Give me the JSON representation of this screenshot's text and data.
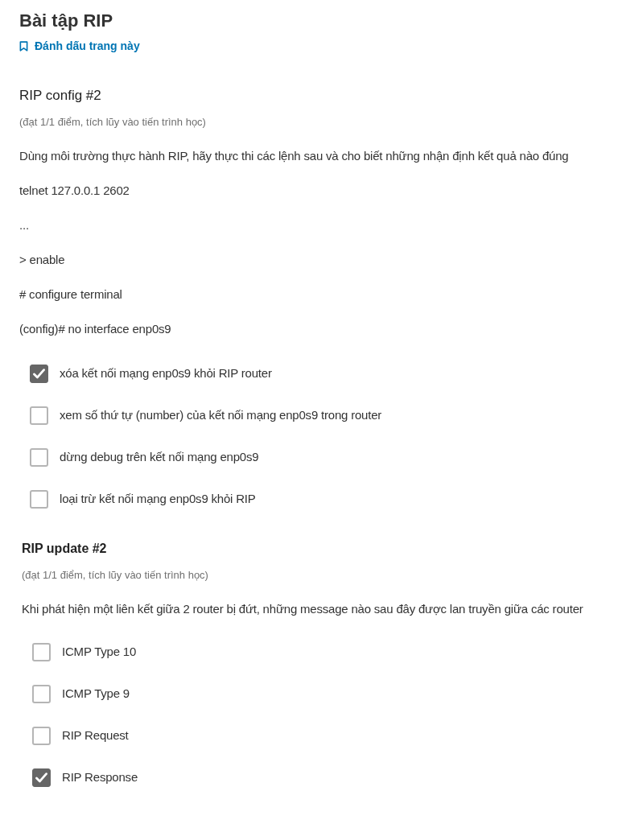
{
  "page": {
    "title": "Bài tập RIP",
    "bookmark": "Đánh dấu trang này"
  },
  "problems": [
    {
      "title": "RIP config #2",
      "score": "(đạt 1/1 điểm, tích lũy vào tiến trình học)",
      "prompt": [
        "Dùng môi trường thực hành RIP, hãy thực thi các lệnh sau và cho biết những nhận định kết quả nào đúng",
        "telnet 127.0.0.1 2602",
        "...",
        "> enable",
        "# configure terminal",
        "(config)# no interface enp0s9"
      ],
      "choices": [
        {
          "label": "xóa kết nối mạng enp0s9 khỏi RIP router",
          "checked": true
        },
        {
          "label": "xem số thứ tự (number) của kết nối mạng enp0s9 trong router",
          "checked": false
        },
        {
          "label": "dừng debug trên kết nối mạng enp0s9",
          "checked": false
        },
        {
          "label": "loại trừ kết nối mạng enp0s9 khỏi RIP",
          "checked": false
        }
      ]
    },
    {
      "title": "RIP update #2",
      "score": "(đạt 1/1 điểm, tích lũy vào tiến trình học)",
      "prompt": [
        "Khi phát hiện một liên kết giữa 2 router bị đứt, những message nào sau đây được lan truyền giữa các router"
      ],
      "choices": [
        {
          "label": "ICMP Type 10",
          "checked": false
        },
        {
          "label": "ICMP Type 9",
          "checked": false
        },
        {
          "label": "RIP Request",
          "checked": false
        },
        {
          "label": "RIP Response",
          "checked": true
        }
      ]
    }
  ]
}
